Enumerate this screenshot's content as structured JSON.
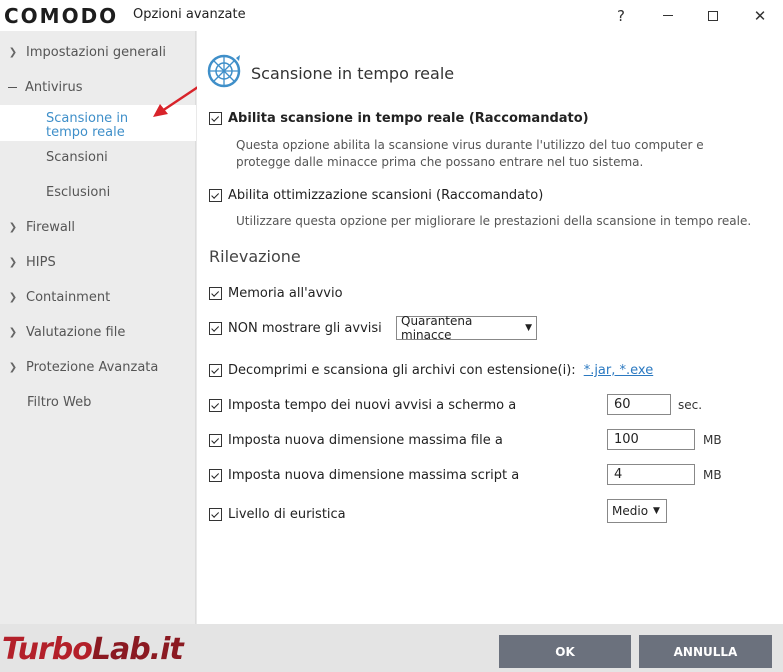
{
  "window": {
    "logo": "COMODO",
    "title": "Opzioni avanzate",
    "help": "?",
    "close": "✕"
  },
  "sidebar": {
    "items": [
      {
        "label": "Impostazioni generali"
      },
      {
        "label": "Antivirus"
      },
      {
        "label": "Scansione in tempo reale"
      },
      {
        "label": "Scansioni"
      },
      {
        "label": "Esclusioni"
      },
      {
        "label": "Firewall"
      },
      {
        "label": "HIPS"
      },
      {
        "label": "Containment"
      },
      {
        "label": "Valutazione file"
      },
      {
        "label": "Protezione Avanzata"
      },
      {
        "label": "Filtro Web"
      }
    ]
  },
  "main": {
    "title": "Scansione in tempo reale",
    "option1": {
      "label": "Abilita scansione in tempo reale (Raccomandato)",
      "checked": true,
      "desc": "Questa opzione abilita la scansione virus durante l'utilizzo del tuo computer e protegge dalle minacce prima che possano entrare nel tuo sistema."
    },
    "option2": {
      "label": "Abilita ottimizzazione scansioni (Raccomandato)",
      "checked": true,
      "desc": "Utilizzare questa opzione per migliorare le prestazioni della scansione in tempo reale."
    },
    "section_title": "Rilevazione",
    "detection": {
      "memory": {
        "label": "Memoria all'avvio",
        "checked": true
      },
      "alerts": {
        "label": "NON mostrare gli avvisi",
        "checked": true,
        "select_value": "Quarantena minacce"
      },
      "archives": {
        "label": "Decomprimi e scansiona gli archivi con estensione(i):",
        "checked": true,
        "link": "*.jar, *.exe"
      },
      "timeout": {
        "label": "Imposta tempo dei nuovi avvisi a schermo a",
        "checked": true,
        "value": "60",
        "unit": "sec."
      },
      "maxfile": {
        "label": "Imposta nuova dimensione massima file a",
        "checked": true,
        "value": "100",
        "unit": "MB"
      },
      "maxscript": {
        "label": "Imposta nuova dimensione massima script a",
        "checked": true,
        "value": "4",
        "unit": "MB"
      },
      "heuristics": {
        "label": "Livello di euristica",
        "checked": true,
        "select_value": "Medio"
      }
    }
  },
  "footer": {
    "ok": "OK",
    "cancel": "ANNULLA",
    "watermark_a": "Turbo",
    "watermark_b": "Lab.it"
  },
  "colors": {
    "accent": "#3f8fc9",
    "button": "#6b717d",
    "arrow": "#d8232a"
  }
}
